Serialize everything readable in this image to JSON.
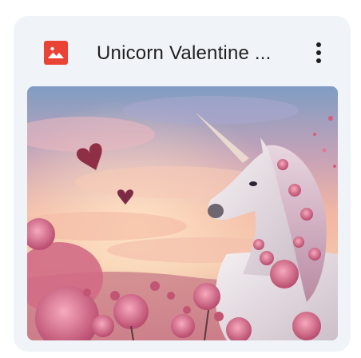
{
  "file": {
    "title": "Unicorn Valentine ...",
    "type_icon": "image-file-icon",
    "type_icon_color": "#ea4335",
    "more_icon": "more-vert-icon"
  },
  "thumbnail": {
    "description_icon": "image-thumbnail"
  }
}
